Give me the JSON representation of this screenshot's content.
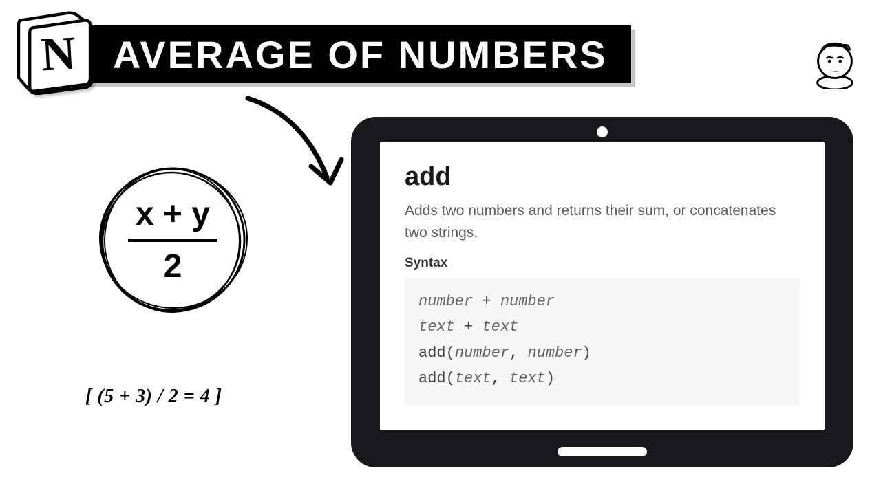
{
  "header": {
    "logo_letter": "N",
    "title": "AVERAGE OF NUMBERS"
  },
  "formula": {
    "numerator": "x + y",
    "denominator": "2"
  },
  "example": "[ (5 + 3) / 2 = 4 ]",
  "doc": {
    "heading": "add",
    "description": "Adds two numbers and returns their sum, or concatenates two strings.",
    "syntax_label": "Syntax",
    "code": {
      "l1a": "number",
      "l1b": " + ",
      "l1c": "number",
      "l2a": "text",
      "l2b": " + ",
      "l2c": "text",
      "l3a": "add(",
      "l3b": "number",
      "l3c": ", ",
      "l3d": "number",
      "l3e": ")",
      "l4a": "add(",
      "l4b": "text",
      "l4c": ", ",
      "l4d": "text",
      "l4e": ")"
    }
  }
}
